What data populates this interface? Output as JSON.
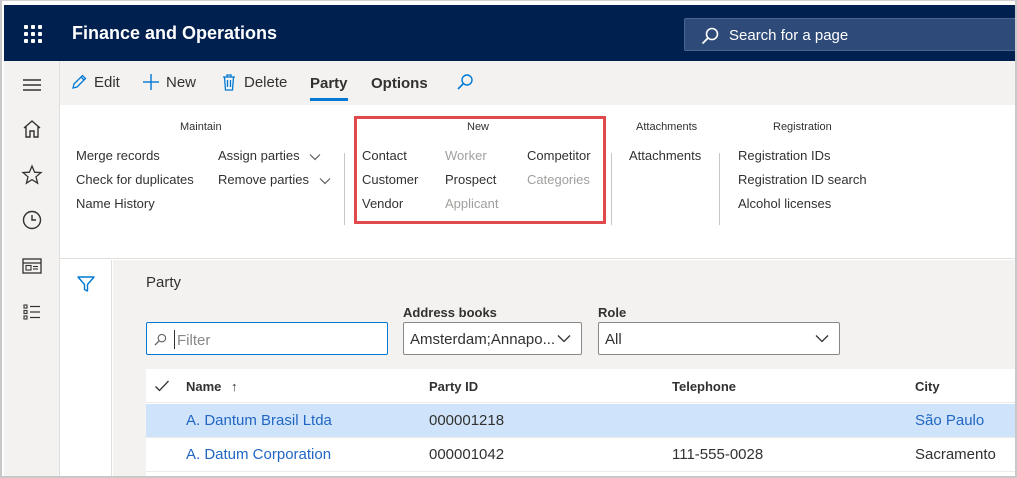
{
  "topbar": {
    "app_title": "Finance and Operations",
    "search_placeholder": "Search for a page",
    "waffle_icon": "app-launcher-icon",
    "bg_color": "#002050"
  },
  "leftnav": {
    "items": [
      {
        "icon": "hamburger-icon"
      },
      {
        "icon": "home-icon"
      },
      {
        "icon": "star-icon"
      },
      {
        "icon": "clock-icon"
      },
      {
        "icon": "workspace-icon"
      },
      {
        "icon": "modules-list-icon"
      }
    ]
  },
  "actionbar": {
    "edit": "Edit",
    "new": "New",
    "delete": "Delete",
    "tab_party": "Party",
    "tab_options": "Options"
  },
  "ribbon": {
    "groups": {
      "maintain": {
        "title": "Maintain",
        "items": [
          "Merge records",
          "Check for duplicates",
          "Name History",
          "Assign parties",
          "Remove parties"
        ]
      },
      "new": {
        "title": "New",
        "items": [
          "Contact",
          "Customer",
          "Vendor",
          "Worker",
          "Prospect",
          "Applicant",
          "Competitor",
          "Categories"
        ]
      },
      "attachments": {
        "title": "Attachments",
        "items": [
          "Attachments"
        ]
      },
      "registration": {
        "title": "Registration",
        "items": [
          "Registration IDs",
          "Registration ID search",
          "Alcohol licenses"
        ]
      }
    },
    "highlight_color": "#e04a4a"
  },
  "content": {
    "title": "Party",
    "filter_placeholder": "Filter",
    "address_books_label": "Address books",
    "address_books_value": "Amsterdam;Annapo...",
    "role_label": "Role",
    "role_value": "All"
  },
  "grid": {
    "columns": [
      "Name",
      "Party ID",
      "Telephone",
      "City"
    ],
    "sort_indicator": "↑",
    "rows": [
      {
        "name": "A. Dantum Brasil Ltda",
        "party_id": "000001218",
        "telephone": "",
        "city": "São Paulo",
        "selected": true
      },
      {
        "name": "A. Datum Corporation",
        "party_id": "000001042",
        "telephone": "111-555-0028",
        "city": "Sacramento",
        "selected": false
      }
    ]
  }
}
